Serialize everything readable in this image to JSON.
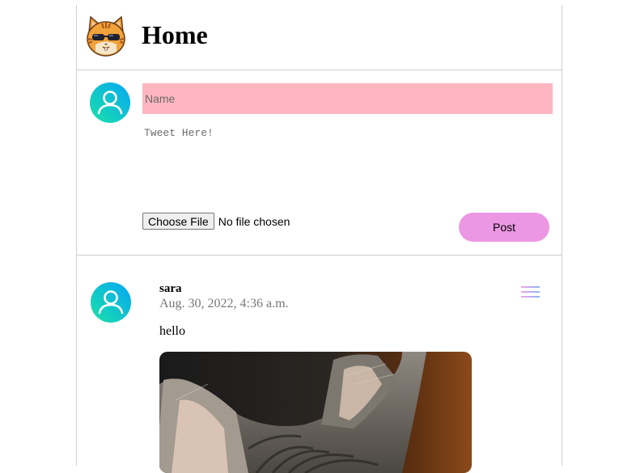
{
  "header": {
    "title": "Home",
    "logo_icon": "cat-sunglasses-logo-icon"
  },
  "composer": {
    "avatar_icon": "user-avatar-icon",
    "name_placeholder": "Name",
    "name_value": "",
    "tweet_placeholder": "Tweet Here!",
    "tweet_value": "",
    "choose_file_label": "Choose File",
    "file_status": "No file chosen",
    "post_label": "Post"
  },
  "tweets": [
    {
      "user": "sara",
      "timestamp": "Aug. 30, 2022, 4:36 a.m.",
      "text": "hello",
      "avatar_icon": "user-avatar-icon",
      "menu_icon": "hamburger-menu-icon",
      "image": "tabby-cat-photo"
    }
  ],
  "colors": {
    "name_input_bg": "#ffb6c1",
    "post_button_bg": "#ec97e3",
    "avatar_gradient_start": "#1be2a6",
    "avatar_gradient_end": "#05a6f5",
    "divider": "#cfcfcf"
  }
}
